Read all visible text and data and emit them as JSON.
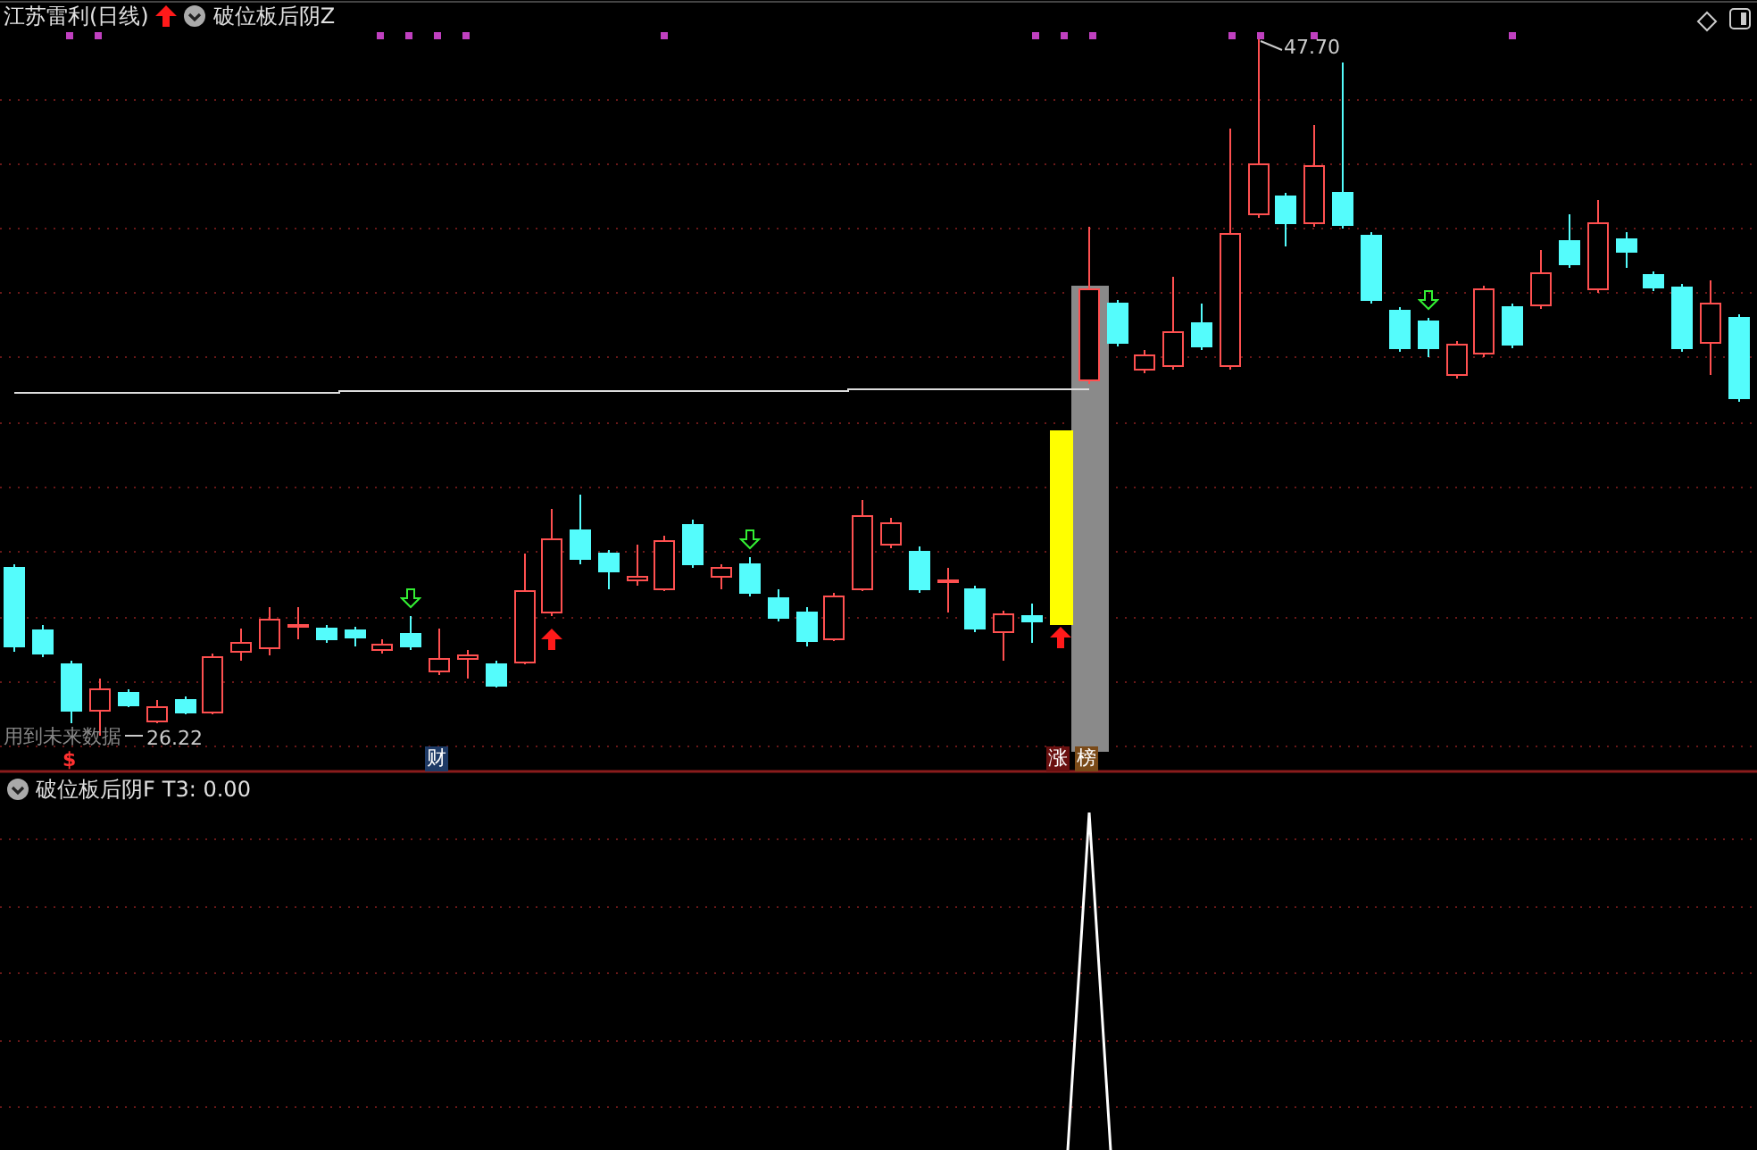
{
  "main_panel": {
    "title": "江苏雷利(日线)",
    "indicator": "破位板后阴Z",
    "high_label": "47.70",
    "low_label": "26.22",
    "warning": "用到未来数据",
    "markers": [
      {
        "kind": "dollar",
        "text": "$"
      },
      {
        "kind": "tag",
        "text": "财",
        "color": "#1e3a66"
      },
      {
        "kind": "tag",
        "text": "涨",
        "color": "#6a1010"
      },
      {
        "kind": "tag",
        "text": "榜",
        "color": "#7a4a18"
      }
    ]
  },
  "lower_panel": {
    "indicator": "破位板后阴F",
    "reading": "T3: 0.00"
  }
}
